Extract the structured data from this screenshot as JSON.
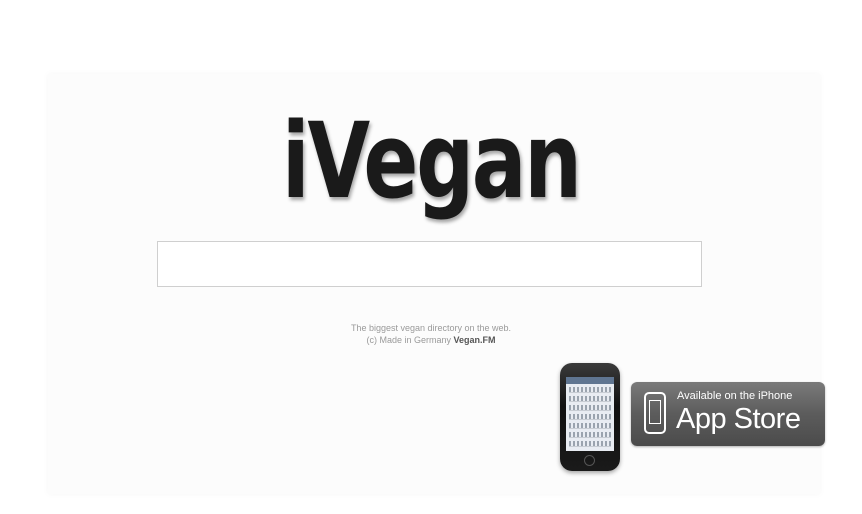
{
  "logo": {
    "text": "iVegan"
  },
  "search": {
    "value": "",
    "placeholder": ""
  },
  "tagline": {
    "line1": "The biggest vegan directory on the web.",
    "line2_prefix": "(c) Made in Germany",
    "line2_brand": "Vegan.FM"
  },
  "appstore": {
    "small_text": "Available on the iPhone",
    "large_text": "App Store"
  },
  "colors": {
    "logo": "#1a1a1a",
    "badge": "#5c5c5c",
    "tagline": "#9a9a9a"
  },
  "icons": [
    "iphone-icon",
    "phone-outline-icon"
  ]
}
